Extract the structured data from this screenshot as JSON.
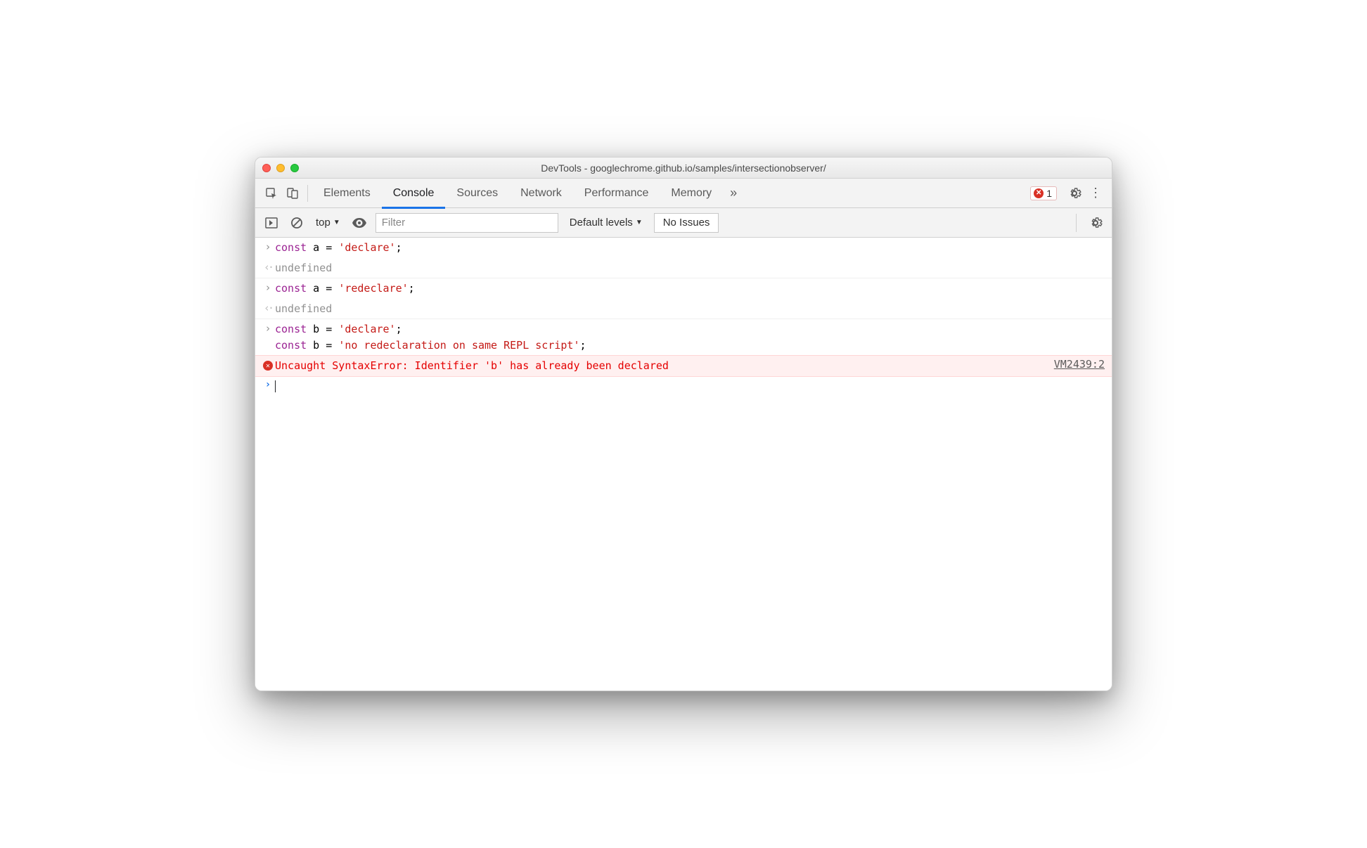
{
  "window": {
    "title": "DevTools - googlechrome.github.io/samples/intersectionobserver/"
  },
  "tabs": {
    "elements": "Elements",
    "console": "Console",
    "sources": "Sources",
    "network": "Network",
    "performance": "Performance",
    "memory": "Memory"
  },
  "error_badge": {
    "count": "1"
  },
  "toolbar": {
    "context": "top",
    "filter_placeholder": "Filter",
    "levels": "Default levels",
    "issues": "No Issues"
  },
  "console": {
    "entries": [
      {
        "type": "input",
        "tokens": [
          {
            "t": "kw",
            "v": "const"
          },
          {
            "t": "txt",
            "v": " a = "
          },
          {
            "t": "str",
            "v": "'declare'"
          },
          {
            "t": "txt",
            "v": ";"
          }
        ]
      },
      {
        "type": "output",
        "tokens": [
          {
            "t": "und",
            "v": "undefined"
          }
        ]
      },
      {
        "type": "input",
        "tokens": [
          {
            "t": "kw",
            "v": "const"
          },
          {
            "t": "txt",
            "v": " a = "
          },
          {
            "t": "str",
            "v": "'redeclare'"
          },
          {
            "t": "txt",
            "v": ";"
          }
        ]
      },
      {
        "type": "output",
        "tokens": [
          {
            "t": "und",
            "v": "undefined"
          }
        ]
      },
      {
        "type": "input-multiline",
        "lines": [
          [
            {
              "t": "kw",
              "v": "const"
            },
            {
              "t": "txt",
              "v": " b = "
            },
            {
              "t": "str",
              "v": "'declare'"
            },
            {
              "t": "txt",
              "v": ";"
            }
          ],
          [
            {
              "t": "kw",
              "v": "const"
            },
            {
              "t": "txt",
              "v": " b = "
            },
            {
              "t": "str",
              "v": "'no redeclaration on same REPL script'"
            },
            {
              "t": "txt",
              "v": ";"
            }
          ]
        ]
      },
      {
        "type": "error",
        "text": "Uncaught SyntaxError: Identifier 'b' has already been declared",
        "source": "VM2439:2"
      }
    ]
  }
}
